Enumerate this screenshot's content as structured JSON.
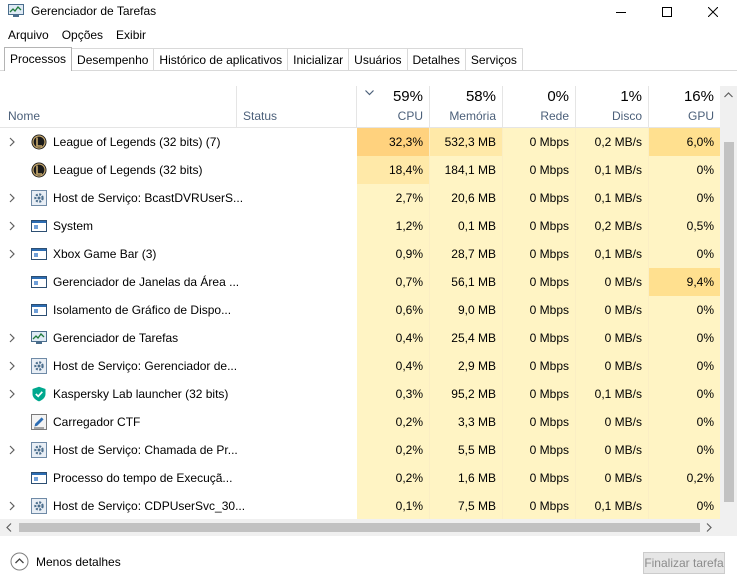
{
  "window": {
    "title": "Gerenciador de Tarefas"
  },
  "menu": [
    "Arquivo",
    "Opções",
    "Exibir"
  ],
  "tabs": [
    "Processos",
    "Desempenho",
    "Histórico de aplicativos",
    "Inicializar",
    "Usuários",
    "Detalhes",
    "Serviços"
  ],
  "columns": {
    "name": "Nome",
    "status": "Status",
    "cpu": {
      "pct": "59%",
      "label": "CPU"
    },
    "memory": {
      "pct": "58%",
      "label": "Memória"
    },
    "network": {
      "pct": "0%",
      "label": "Rede"
    },
    "disk": {
      "pct": "1%",
      "label": "Disco"
    },
    "gpu": {
      "pct": "16%",
      "label": "GPU"
    }
  },
  "processes": [
    {
      "name": "League of Legends (32 bits) (7)",
      "icon": "league-of-legends-icon",
      "expandable": true,
      "cpu": "32,3%",
      "memory": "532,3 MB",
      "network": "0 Mbps",
      "disk": "0,2 MB/s",
      "gpu": "6,0%"
    },
    {
      "name": "League of Legends (32 bits)",
      "icon": "league-of-legends-icon",
      "expandable": false,
      "cpu": "18,4%",
      "memory": "184,1 MB",
      "network": "0 Mbps",
      "disk": "0,1 MB/s",
      "gpu": "0%"
    },
    {
      "name": "Host de Serviço: BcastDVRUserS...",
      "icon": "gear-icon",
      "expandable": true,
      "cpu": "2,7%",
      "memory": "20,6 MB",
      "network": "0 Mbps",
      "disk": "0,1 MB/s",
      "gpu": "0%"
    },
    {
      "name": "System",
      "icon": "window-app-icon",
      "expandable": true,
      "cpu": "1,2%",
      "memory": "0,1 MB",
      "network": "0 Mbps",
      "disk": "0,2 MB/s",
      "gpu": "0,5%"
    },
    {
      "name": "Xbox Game Bar (3)",
      "icon": "window-app-icon",
      "expandable": true,
      "cpu": "0,9%",
      "memory": "28,7 MB",
      "network": "0 Mbps",
      "disk": "0,1 MB/s",
      "gpu": "0%"
    },
    {
      "name": "Gerenciador de Janelas da Área ...",
      "icon": "window-app-icon",
      "expandable": false,
      "cpu": "0,7%",
      "memory": "56,1 MB",
      "network": "0 Mbps",
      "disk": "0 MB/s",
      "gpu": "9,4%"
    },
    {
      "name": "Isolamento de Gráfico de Dispo...",
      "icon": "window-app-icon",
      "expandable": false,
      "cpu": "0,6%",
      "memory": "9,0 MB",
      "network": "0 Mbps",
      "disk": "0 MB/s",
      "gpu": "0%"
    },
    {
      "name": "Gerenciador de Tarefas",
      "icon": "task-manager-icon",
      "expandable": true,
      "cpu": "0,4%",
      "memory": "25,4 MB",
      "network": "0 Mbps",
      "disk": "0 MB/s",
      "gpu": "0%"
    },
    {
      "name": "Host de Serviço: Gerenciador de...",
      "icon": "gear-icon",
      "expandable": true,
      "cpu": "0,4%",
      "memory": "2,9 MB",
      "network": "0 Mbps",
      "disk": "0 MB/s",
      "gpu": "0%"
    },
    {
      "name": "Kaspersky Lab launcher (32 bits)",
      "icon": "kaspersky-shield-icon",
      "expandable": true,
      "cpu": "0,3%",
      "memory": "95,2 MB",
      "network": "0 Mbps",
      "disk": "0,1 MB/s",
      "gpu": "0%"
    },
    {
      "name": "Carregador CTF",
      "icon": "ctf-pen-icon",
      "expandable": false,
      "cpu": "0,2%",
      "memory": "3,3 MB",
      "network": "0 Mbps",
      "disk": "0 MB/s",
      "gpu": "0%"
    },
    {
      "name": "Host de Serviço: Chamada de Pr...",
      "icon": "gear-icon",
      "expandable": true,
      "cpu": "0,2%",
      "memory": "5,5 MB",
      "network": "0 Mbps",
      "disk": "0 MB/s",
      "gpu": "0%"
    },
    {
      "name": "Processo do tempo de Execuçã...",
      "icon": "window-app-icon",
      "expandable": false,
      "cpu": "0,2%",
      "memory": "1,6 MB",
      "network": "0 Mbps",
      "disk": "0 MB/s",
      "gpu": "0,2%"
    },
    {
      "name": "Host de Serviço: CDPUserSvc_30...",
      "icon": "gear-icon",
      "expandable": true,
      "cpu": "0,1%",
      "memory": "7,5 MB",
      "network": "0 Mbps",
      "disk": "0,1 MB/s",
      "gpu": "0%"
    }
  ],
  "footer": {
    "less_details": "Menos detalhes",
    "end_task": "Finalizar tarefa"
  },
  "colors": {
    "heat_low": "#fff4c4",
    "heat_mid": "#ffe9a8",
    "heat_high": "#ffd27e",
    "heat_gpu_high": "#ffe08f",
    "header_label": "#4c607a"
  }
}
